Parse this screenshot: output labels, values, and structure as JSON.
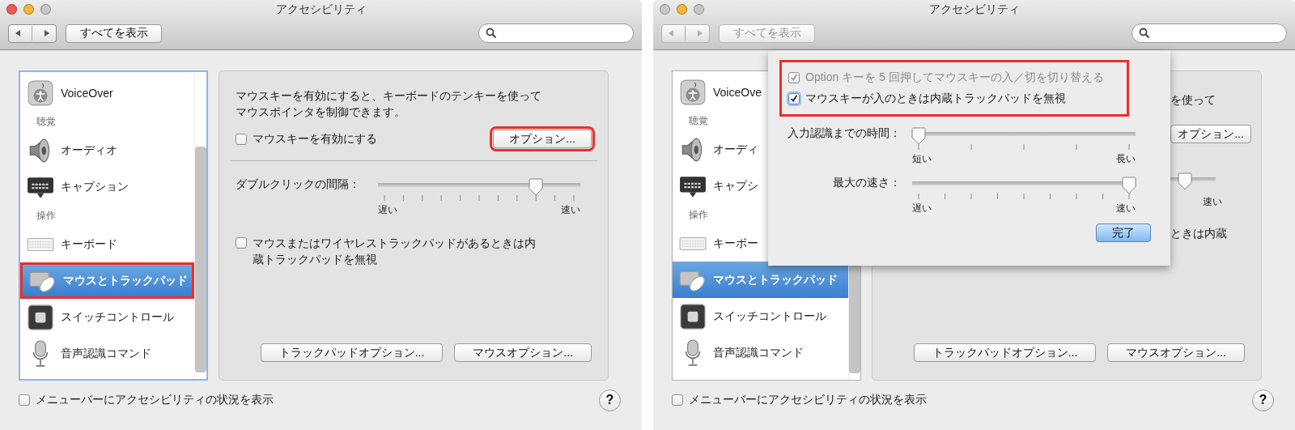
{
  "windows": [
    {
      "title": "アクセシビリティ",
      "traffic_lights": [
        {
          "color": "#ee5b52"
        },
        {
          "color": "#f3b73a"
        },
        {
          "color": "#c8c8c8"
        }
      ],
      "toolbar": {
        "nav_disabled": false,
        "show_all": {
          "label": "すべてを表示",
          "disabled": false
        }
      },
      "sidebar": {
        "focused": true,
        "items": [
          {
            "kind": "voiceover",
            "label": "VoiceOver",
            "selected": false,
            "highlighted": false
          },
          {
            "kind": "header",
            "label": "聴覚"
          },
          {
            "kind": "speaker",
            "label": "オーディオ",
            "selected": false,
            "highlighted": false
          },
          {
            "kind": "caption",
            "label": "キャプション",
            "selected": false,
            "highlighted": false
          },
          {
            "kind": "header",
            "label": "操作"
          },
          {
            "kind": "keyboard",
            "label": "キーボード",
            "selected": false,
            "highlighted": false
          },
          {
            "kind": "mouse",
            "label": "マウスとトラックパッド",
            "selected": true,
            "highlighted": true
          },
          {
            "kind": "switch",
            "label": "スイッチコントロール",
            "selected": false,
            "highlighted": false
          },
          {
            "kind": "microphone",
            "label": "音声認識コマンド",
            "selected": false,
            "highlighted": false
          }
        ]
      },
      "panel": {
        "description": "マウスキーを有効にすると、キーボードのテンキーを使ってマウスポインタを制御できます。",
        "mouse_keys": {
          "label": "マウスキーを有効にする",
          "checked": false
        },
        "options_button": {
          "label": "オプション...",
          "highlighted": true
        },
        "slider": {
          "label": "ダブルクリックの間隔：",
          "level": 0.8,
          "min_label": "遅い",
          "max_label": "速い"
        },
        "ignore_trackpad": {
          "label": "マウスまたはワイヤレストラックパッドがあるときは内蔵トラックパッドを無視",
          "checked": false
        },
        "buttons": [
          "トラックパッドオプション...",
          "マウスオプション..."
        ]
      },
      "footer": {
        "status_checkbox": {
          "label": "メニューバーにアクセシビリティの状況を表示",
          "checked": false
        },
        "help": "?"
      }
    },
    {
      "title": "アクセシビリティ",
      "traffic_lights": [
        {
          "color": "#c8c8c8"
        },
        {
          "color": "#f3b73a"
        },
        {
          "color": "#c8c8c8"
        }
      ],
      "toolbar": {
        "nav_disabled": true,
        "show_all": {
          "label": "すべてを表示",
          "disabled": true
        }
      },
      "sidebar": {
        "focused": false,
        "items": [
          {
            "kind": "voiceover",
            "label": "VoiceOve",
            "selected": false,
            "highlighted": false
          },
          {
            "kind": "header",
            "label": "聴覚"
          },
          {
            "kind": "speaker",
            "label": "オーディ",
            "selected": false,
            "highlighted": false
          },
          {
            "kind": "caption",
            "label": "キャプシ",
            "selected": false,
            "highlighted": false
          },
          {
            "kind": "header",
            "label": "操作"
          },
          {
            "kind": "keyboard",
            "label": "キーボー",
            "selected": false,
            "highlighted": false
          },
          {
            "kind": "mouse",
            "label": "マウスとトラックパッド",
            "selected": true,
            "highlighted": false
          },
          {
            "kind": "switch",
            "label": "スイッチコントロール",
            "selected": false,
            "highlighted": false
          },
          {
            "kind": "microphone",
            "label": "音声認識コマンド",
            "selected": false,
            "highlighted": false
          }
        ]
      },
      "panel": {
        "description_end": "を使って",
        "options_button": {
          "label": "オプション...",
          "highlighted": false
        },
        "slider": {
          "level": 0.33,
          "max_label": "速い"
        },
        "checkbox_end": "ときは内蔵",
        "buttons": [
          "トラックパッドオプション...",
          "マウスオプション..."
        ]
      },
      "footer": {
        "status_checkbox": {
          "label": "メニューバーにアクセシビリティの状況を表示",
          "checked": false
        },
        "help": "?"
      },
      "sheet": {
        "checkbox_group": {
          "highlighted": true,
          "items": [
            {
              "label": "Option キーを 5 回押してマウスキーの入／切を切り替える",
              "checked": true,
              "disabled": true
            },
            {
              "label": "マウスキーが入のときは内蔵トラックパッドを無視",
              "checked": true,
              "disabled": false
            }
          ]
        },
        "sliders": [
          {
            "label": "入力認識までの時間：",
            "level": 0,
            "min_label": "短い",
            "max_label": "長い"
          },
          {
            "label": "最大の速さ：",
            "level": 1,
            "min_label": "遅い",
            "max_label": "速い"
          }
        ],
        "done_button": {
          "label": "完了",
          "default": true
        }
      }
    }
  ]
}
